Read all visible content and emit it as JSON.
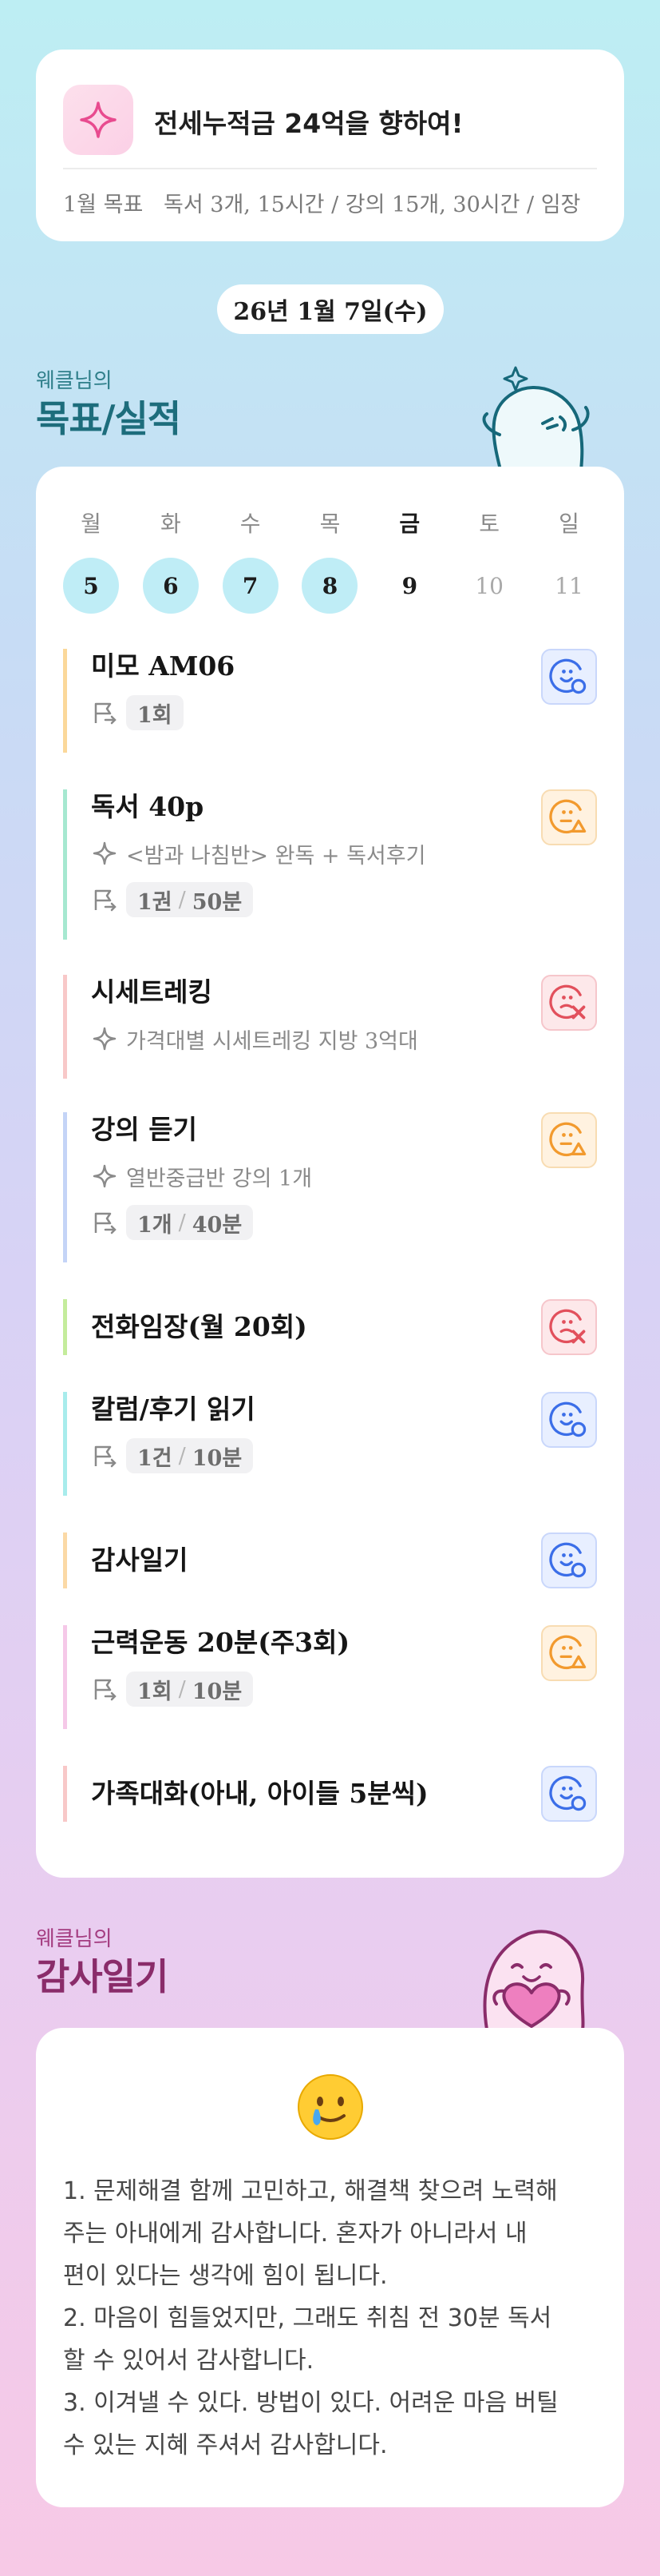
{
  "goal_card": {
    "title": "전세누적금 24억을 향하여!",
    "subtitle": "1월 목표   독서 3개, 15시간 / 강의 15개, 30시간 / 임장",
    "icon": "sparkle-icon"
  },
  "date_label": "26년 1월 7일(수)",
  "goals_section": {
    "small": "웨클님의",
    "big": "목표/실적"
  },
  "week": [
    {
      "day": "월",
      "num": "5",
      "state": "done"
    },
    {
      "day": "화",
      "num": "6",
      "state": "done"
    },
    {
      "day": "수",
      "num": "7",
      "state": "done"
    },
    {
      "day": "목",
      "num": "8",
      "state": "done"
    },
    {
      "day": "금",
      "num": "9",
      "state": "today"
    },
    {
      "day": "토",
      "num": "10",
      "state": "future"
    },
    {
      "day": "일",
      "num": "11",
      "state": "future"
    }
  ],
  "tasks": [
    {
      "title": "미모 AM06",
      "desc": "",
      "chip_a": "1회",
      "chip_b": "",
      "status": "good",
      "accent": "#fbd89a"
    },
    {
      "title": "독서 40p",
      "desc": "<밤과 나침반> 완독 + 독서후기",
      "chip_a": "1권",
      "chip_b": "50분",
      "status": "soso",
      "accent": "#a6e8d0"
    },
    {
      "title": "시세트레킹",
      "desc": "가격대별 시세트레킹 지방 3억대",
      "chip_a": "",
      "chip_b": "",
      "status": "bad",
      "accent": "#f8c8c8"
    },
    {
      "title": "강의 듣기",
      "desc": "열반중급반 강의 1개",
      "chip_a": "1개",
      "chip_b": "40분",
      "status": "soso",
      "accent": "#c4d4f7"
    },
    {
      "title": "전화임장(월 20회)",
      "desc": "",
      "chip_a": "",
      "chip_b": "",
      "status": "bad",
      "accent": "#c4ec9c"
    },
    {
      "title": "칼럼/후기 읽기",
      "desc": "",
      "chip_a": "1건",
      "chip_b": "10분",
      "status": "good",
      "accent": "#a8ecec"
    },
    {
      "title": "감사일기",
      "desc": "",
      "chip_a": "",
      "chip_b": "",
      "status": "good",
      "accent": "#fbd9a6"
    },
    {
      "title": "근력운동 20분(주3회)",
      "desc": "",
      "chip_a": "1회",
      "chip_b": "10분",
      "status": "soso",
      "accent": "#f5c8e8"
    },
    {
      "title": "가족대화(아내, 아이들 5분씩)",
      "desc": "",
      "chip_a": "",
      "chip_b": "",
      "status": "good",
      "accent": "#f8c8c8"
    }
  ],
  "diary_section": {
    "small": "웨클님의",
    "big": "감사일기"
  },
  "diary": {
    "mood_icon": "teary-smile-emoji",
    "lines": [
      "1. 문제해결 함께 고민하고, 해결책 찾으려 노력해",
      "주는 아내에게 감사합니다. 혼자가 아니라서 내",
      "편이 있다는 생각에 힘이 됩니다.",
      "2. 마음이 힘들었지만, 그래도 취침 전 30분 독서",
      "할 수 있어서 감사합니다.",
      "3. 이겨낼 수 있다. 방법이 있다. 어려운 마음 버틸",
      "수 있는 지혜 주셔서 감사합니다."
    ]
  },
  "colors": {
    "good": "#3b6ee8",
    "soso": "#f29a2e",
    "bad": "#e2505c",
    "goal_heading": "#1d6d7c",
    "diary_heading": "#8a2c6a"
  }
}
